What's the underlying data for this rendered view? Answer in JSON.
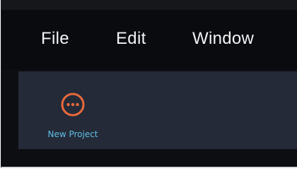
{
  "menu": {
    "file_label": "File",
    "edit_label": "Edit",
    "window_label": "Window"
  },
  "toolbar": {
    "new_project": {
      "label": "New Project",
      "icon": "more-horizontal-circle-icon",
      "icon_color": "#e8693c",
      "label_color": "#5fbfe8"
    }
  },
  "colors": {
    "menubar_bg": "#090b0e",
    "toolbar_bg": "#242a37",
    "menu_text": "#f2f3f5"
  }
}
